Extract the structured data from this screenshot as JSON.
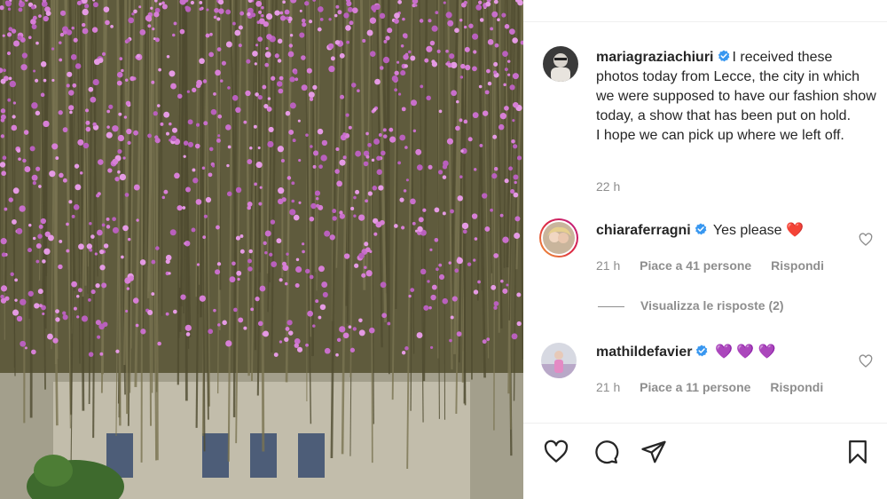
{
  "post": {
    "author": "mariagraziachiuri",
    "caption": "I received these photos today from Lecce, the city in which we were supposed to have our fashion show today, a show that has been put on hold.\nI hope we can pick up where we left off.",
    "time": "22 h"
  },
  "comments": [
    {
      "username": "chiaraferragni",
      "text": "Yes please",
      "emoji": "❤️",
      "time": "21 h",
      "likes": "Piace a 41 persone",
      "reply": "Rispondi"
    },
    {
      "username": "mathildefavier",
      "text": "",
      "emoji": "💜 💜 💜",
      "time": "21 h",
      "likes": "Piace a 11 persone",
      "reply": "Rispondi"
    }
  ],
  "view_replies": "Visualizza le risposte (2)",
  "icons": {
    "verified": "verified-badge-icon",
    "like": "heart-icon",
    "comment": "comment-bubble-icon",
    "share": "paper-plane-icon",
    "save": "bookmark-icon"
  },
  "colors": {
    "verified": "#3897f0",
    "heart_red": "#ed4956",
    "purple_heart": "#9b4dd6",
    "secondary_text": "#8e8e8e",
    "flower_pink": "#d77fd6"
  }
}
